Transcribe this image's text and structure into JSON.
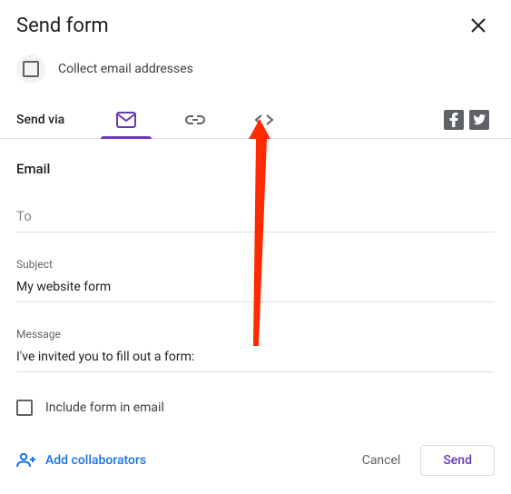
{
  "header": {
    "title": "Send form"
  },
  "collect": {
    "label": "Collect email addresses"
  },
  "sendVia": {
    "label": "Send via"
  },
  "email": {
    "section_title": "Email",
    "to_label": "To",
    "to_value": "",
    "subject_label": "Subject",
    "subject_value": "My website form",
    "message_label": "Message",
    "message_value": "I've invited you to fill out a form:"
  },
  "include": {
    "label": "Include form in email"
  },
  "footer": {
    "add_collaborators": "Add collaborators",
    "cancel": "Cancel",
    "send": "Send"
  }
}
